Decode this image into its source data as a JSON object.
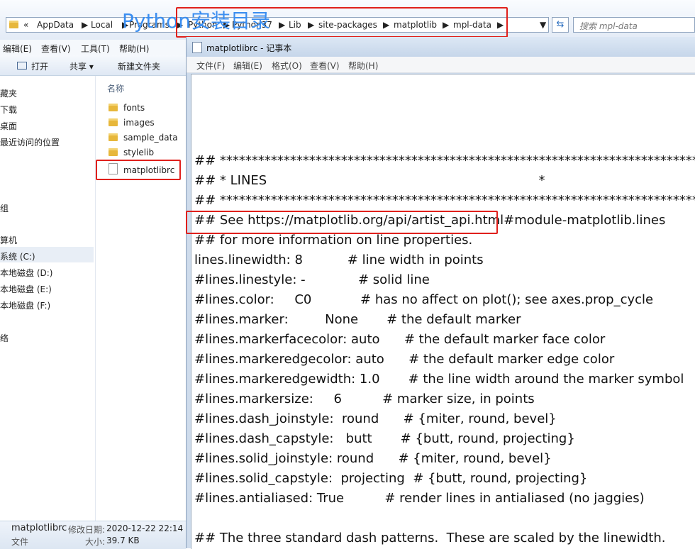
{
  "explorer": {
    "address": {
      "prefix": "«",
      "crumbs": [
        "AppData",
        "Local",
        "Programs",
        "Python",
        "Python37",
        "Lib",
        "site-packages",
        "matplotlib",
        "mpl-data"
      ]
    },
    "search_placeholder": "搜索 mpl-data",
    "menu": [
      "编辑(E)",
      "查看(V)",
      "工具(T)",
      "帮助(H)"
    ],
    "toolbar": {
      "open": "打开",
      "share": "共享 ▾",
      "new_folder": "新建文件夹"
    },
    "nav_items": [
      "藏夹",
      "下载",
      "桌面",
      "最近访问的位置",
      "组",
      "算机",
      "系统 (C:)",
      "本地磁盘 (D:)",
      "本地磁盘 (E:)",
      "本地磁盘 (F:)",
      "络"
    ],
    "column_header": "名称",
    "files": [
      {
        "name": "fonts",
        "type": "folder"
      },
      {
        "name": "images",
        "type": "folder"
      },
      {
        "name": "sample_data",
        "type": "folder"
      },
      {
        "name": "stylelib",
        "type": "folder"
      },
      {
        "name": "matplotlibrc",
        "type": "file"
      }
    ],
    "details": {
      "name": "matplotlibrc",
      "modified_label": "修改日期:",
      "modified_value": "2020-12-22 22:14",
      "type": "文件",
      "size_label": "大小:",
      "size_value": "39.7 KB"
    }
  },
  "annotation": {
    "label": "Python安装目录",
    "color": "#3b8ef0",
    "box_color": "#e0201c"
  },
  "notepad": {
    "title": "matplotlibrc - 记事本",
    "menu": [
      "文件(F)",
      "编辑(E)",
      "格式(O)",
      "查看(V)",
      "帮助(H)"
    ],
    "lines": [
      "## ***************************************************************************",
      "## * LINES                                                                   *",
      "## ***************************************************************************",
      "## See https://matplotlib.org/api/artist_api.html#module-matplotlib.lines",
      "## for more information on line properties.",
      "lines.linewidth: 8           # line width in points",
      "#lines.linestyle: -             # solid line",
      "#lines.color:     C0            # has no affect on plot(); see axes.prop_cycle",
      "#lines.marker:         None       # the default marker",
      "#lines.markerfacecolor: auto      # the default marker face color",
      "#lines.markeredgecolor: auto      # the default marker edge color",
      "#lines.markeredgewidth: 1.0       # the line width around the marker symbol",
      "#lines.markersize:     6          # marker size, in points",
      "#lines.dash_joinstyle:  round      # {miter, round, bevel}",
      "#lines.dash_capstyle:   butt       # {butt, round, projecting}",
      "#lines.solid_joinstyle: round      # {miter, round, bevel}",
      "#lines.solid_capstyle:  projecting  # {butt, round, projecting}",
      "#lines.antialiased: True          # render lines in antialiased (no jaggies)",
      "",
      "## The three standard dash patterns.  These are scaled by the linewidth."
    ]
  }
}
